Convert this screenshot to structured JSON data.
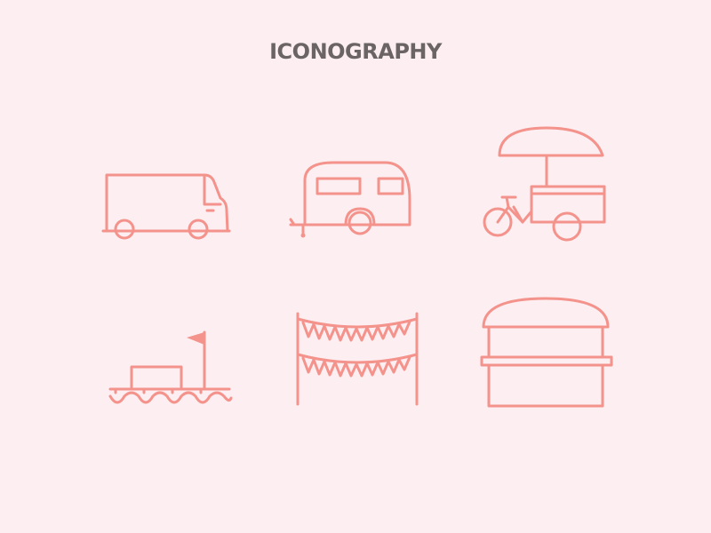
{
  "page": {
    "title": "ICONOGRAPHY",
    "background_color": "#fdeff1",
    "icon_color": "#f4928c",
    "title_color": "#6b6465"
  },
  "icons": [
    {
      "name": "food-truck-van-icon"
    },
    {
      "name": "caravan-trailer-icon"
    },
    {
      "name": "tricycle-cart-umbrella-icon"
    },
    {
      "name": "boat-raft-flag-icon"
    },
    {
      "name": "bunting-flags-icon"
    },
    {
      "name": "market-stall-icon"
    }
  ]
}
